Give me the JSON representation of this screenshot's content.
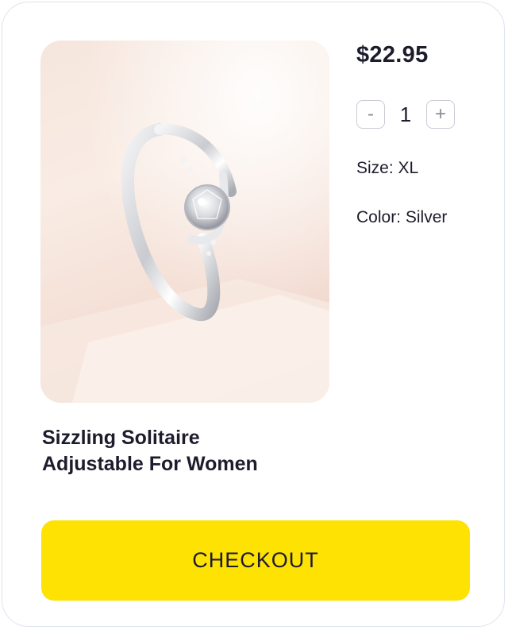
{
  "product": {
    "image_alt": "Silver solitaire ring with crystal stone",
    "price": "$22.95",
    "title_line1": "Sizzling Solitaire",
    "title_line2": "Adjustable For Women",
    "size_label": "Size: XL",
    "color_label": "Color: Silver"
  },
  "quantity": {
    "decrement_symbol": "-",
    "value": "1",
    "increment_symbol": "+"
  },
  "actions": {
    "checkout_label": "CHECKOUT"
  },
  "colors": {
    "accent": "#fde204",
    "text": "#1c1c2c",
    "border": "#dfe3ee"
  }
}
